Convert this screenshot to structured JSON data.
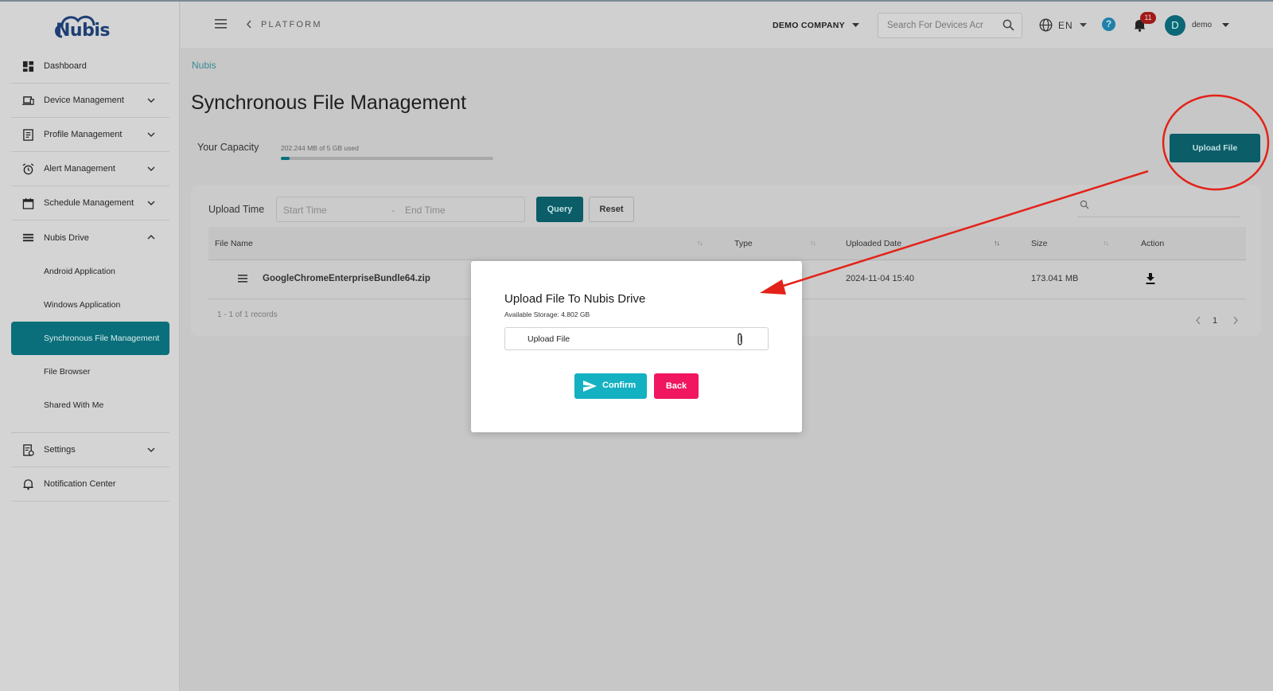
{
  "brand": {
    "logo_text": "Nubis"
  },
  "sidebar": {
    "items": [
      {
        "label": "Dashboard",
        "icon": "dashboard-icon",
        "has_chevron": false
      },
      {
        "label": "Device Management",
        "icon": "devices-icon",
        "has_chevron": true
      },
      {
        "label": "Profile Management",
        "icon": "profile-icon",
        "has_chevron": true
      },
      {
        "label": "Alert Management",
        "icon": "alarm-icon",
        "has_chevron": true
      },
      {
        "label": "Schedule Management",
        "icon": "calendar-icon",
        "has_chevron": true
      },
      {
        "label": "Nubis Drive",
        "icon": "list-icon",
        "expanded": true
      }
    ],
    "drive_sub": [
      {
        "label": "Android Application"
      },
      {
        "label": "Windows Application"
      },
      {
        "label": "Synchronous File Management",
        "active": true
      },
      {
        "label": "File Browser"
      },
      {
        "label": "Shared With Me"
      }
    ],
    "bottom_items": [
      {
        "label": "Settings",
        "icon": "settings-doc-icon",
        "has_chevron": true
      },
      {
        "label": "Notification Center",
        "icon": "bell-outline-icon",
        "has_chevron": false
      }
    ]
  },
  "topbar": {
    "platform": "PLATFORM",
    "company": "DEMO COMPANY",
    "search_placeholder": "Search For Devices Acr",
    "language": "EN",
    "help": "?",
    "notification_count": "11",
    "avatar_letter": "D",
    "user": "demo"
  },
  "breadcrumb": "Nubis",
  "page_title": "Synchronous File Management",
  "capacity": {
    "label": "Your Capacity",
    "usage_text": "202.244 MB of 5 GB used",
    "used_fraction": 0.0395
  },
  "upload_button": "Upload File",
  "filter": {
    "label": "Upload Time",
    "start_placeholder": "Start Time",
    "separator": "-",
    "end_placeholder": "End Time",
    "query": "Query",
    "reset": "Reset"
  },
  "table": {
    "columns": [
      "File Name",
      "Type",
      "Uploaded Date",
      "Size",
      "Action"
    ],
    "rows": [
      {
        "file_name": "GoogleChromeEnterpriseBundle64.zip",
        "type": "",
        "uploaded_date": "2024-11-04 15:40",
        "size": "173.041 MB"
      }
    ],
    "records": "1 - 1 of 1 records",
    "page": "1"
  },
  "modal": {
    "title": "Upload File To Nubis Drive",
    "storage": "Available Storage: 4.802 GB",
    "input_label": "Upload File",
    "confirm": "Confirm",
    "back": "Back"
  },
  "colors": {
    "accent": "#0b6f7b",
    "confirm": "#14b1c2",
    "back": "#f0165f",
    "annotation": "#e32219"
  }
}
